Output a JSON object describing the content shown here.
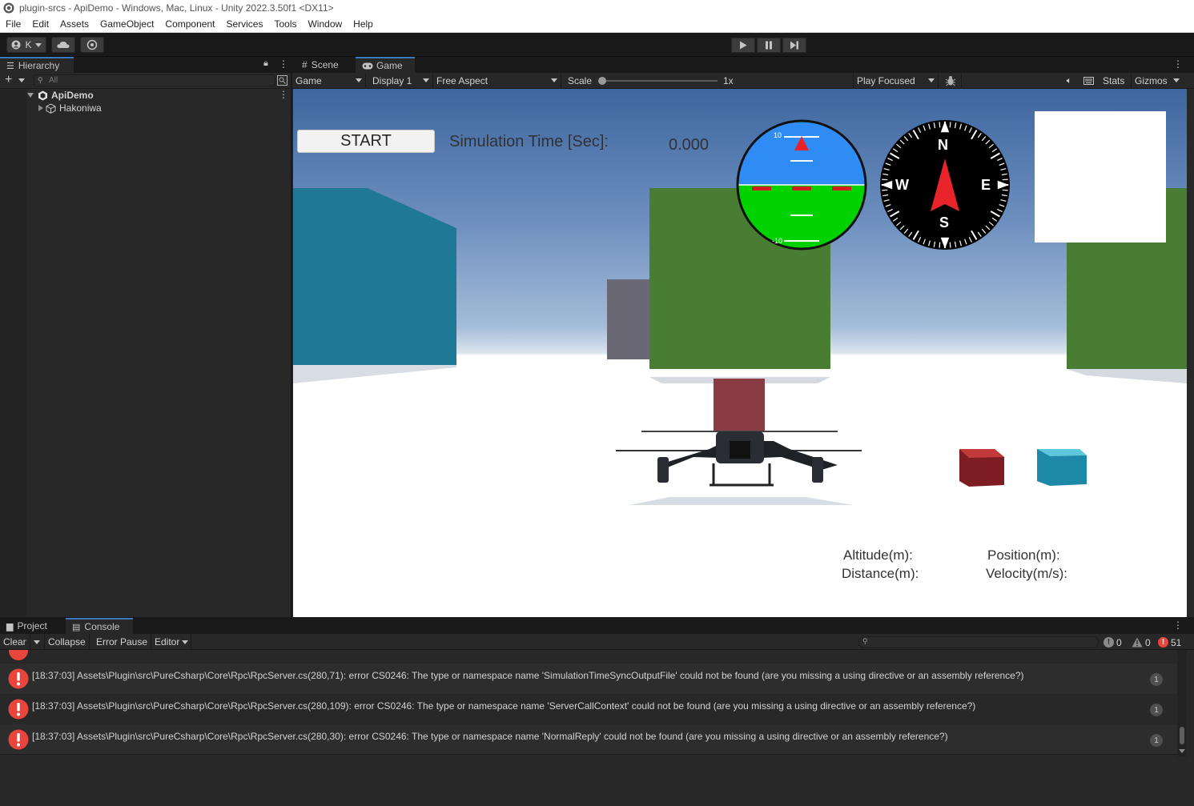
{
  "window": {
    "title": "plugin-srcs - ApiDemo - Windows, Mac, Linux - Unity 2022.3.50f1 <DX11>"
  },
  "menu": [
    "File",
    "Edit",
    "Assets",
    "GameObject",
    "Component",
    "Services",
    "Tools",
    "Window",
    "Help"
  ],
  "toolbar": {
    "account_initial": "K",
    "icons": [
      "account-icon",
      "cloud-icon",
      "collab-icon",
      "play-icon",
      "pause-icon",
      "step-icon"
    ]
  },
  "hierarchy": {
    "tab_label": "Hierarchy",
    "search_placeholder": "All",
    "scene_name": "ApiDemo",
    "child_name": "Hakoniwa"
  },
  "view_tabs": [
    "Scene",
    "Game"
  ],
  "game_bar": {
    "mode": "Game",
    "display": "Display 1",
    "aspect": "Free Aspect",
    "scale_label": "Scale",
    "scale_value": "1x",
    "play_mode": "Play Focused",
    "stats": "Stats",
    "gizmos": "Gizmos"
  },
  "game_ui": {
    "start_button": "START",
    "sim_time_label": "Simulation Time [Sec]:",
    "sim_time_value": "0.000",
    "altitude_label": "Altitude(m):",
    "distance_label": "Distance(m):",
    "position_label": "Position(m):",
    "velocity_label": "Velocity(m/s):",
    "compass": {
      "n": "N",
      "s": "S",
      "e": "E",
      "w": "W"
    },
    "attitude_top": "10",
    "attitude_bottom": "-10"
  },
  "console": {
    "tabs": [
      "Project",
      "Console"
    ],
    "buttons": [
      "Clear",
      "Collapse",
      "Error Pause",
      "Editor"
    ],
    "info_count": "0",
    "warning_count": "0",
    "error_count": "51",
    "logs": [
      {
        "text": "[18:37:03] Assets\\Plugin\\src\\PureCsharp\\Core\\Rpc\\RpcServer.cs(280,71): error CS0246: The type or namespace name 'SimulationTimeSyncOutputFile' could not be found (are you missing a using directive or an assembly reference?)",
        "count": "1"
      },
      {
        "text": "[18:37:03] Assets\\Plugin\\src\\PureCsharp\\Core\\Rpc\\RpcServer.cs(280,109): error CS0246: The type or namespace name 'ServerCallContext' could not be found (are you missing a using directive or an assembly reference?)",
        "count": "1"
      },
      {
        "text": "[18:37:03] Assets\\Plugin\\src\\PureCsharp\\Core\\Rpc\\RpcServer.cs(280,30): error CS0246: The type or namespace name 'NormalReply' could not be found (are you missing a using directive or an assembly reference?)",
        "count": "1"
      }
    ]
  },
  "colors": {
    "accent": "#3a79bb",
    "error": "#e8453c",
    "cube_teal": "#1f7896",
    "cube_green": "#4a7d34",
    "sky_blue": "#2f8cf5",
    "ground_green": "#00d200"
  }
}
